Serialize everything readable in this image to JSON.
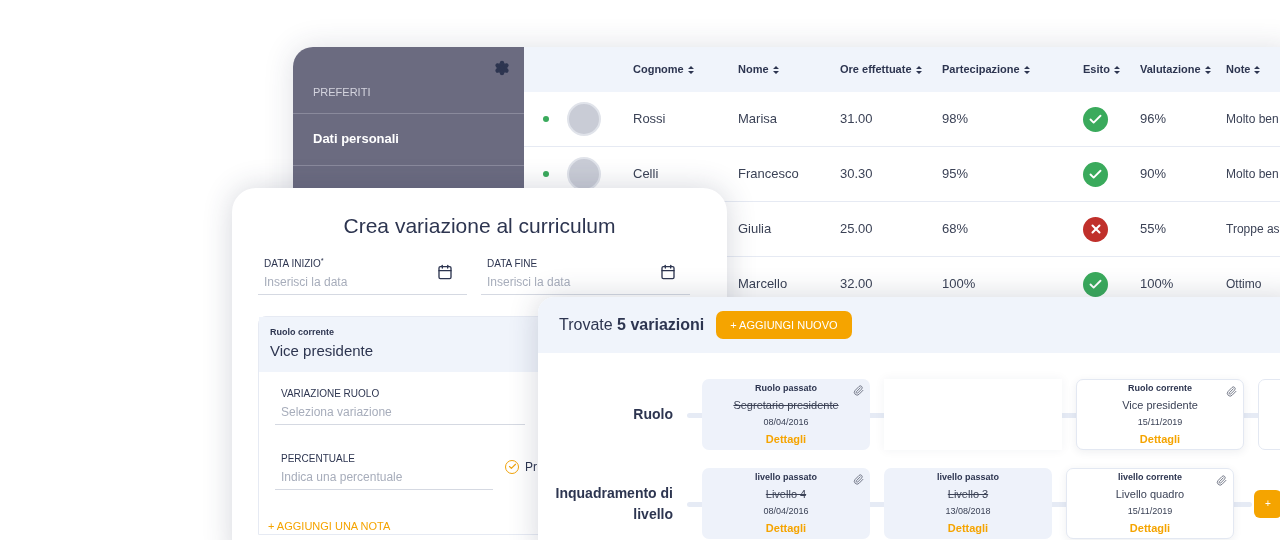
{
  "sidebar": {
    "section_title": "PREFERITI",
    "items": [
      {
        "label": "Dati personali",
        "selected": true
      }
    ]
  },
  "table": {
    "columns": [
      "Cognome",
      "Nome",
      "Ore effettuate",
      "Partecipazione",
      "Esito",
      "Valutazione",
      "Note"
    ],
    "rows": [
      {
        "online": true,
        "avatar": true,
        "cognome": "Rossi",
        "nome": "Marisa",
        "ore": "31.00",
        "partecipazione": "98%",
        "kind": "passed",
        "valutazione": "96%",
        "note": "Molto ben"
      },
      {
        "online": true,
        "avatar": true,
        "cognome": "Celli",
        "nome": "Francesco",
        "ore": "30.30",
        "partecipazione": "95%",
        "kind": "passed",
        "valutazione": "90%",
        "note": "Molto ben"
      },
      {
        "online": false,
        "avatar": false,
        "nome": "Giulia",
        "ore": "25.00",
        "partecipazione": "68%",
        "kind": "failed",
        "valutazione": "55%",
        "note": "Troppe as"
      },
      {
        "online": false,
        "avatar": false,
        "nome": "Marcello",
        "ore": "32.00",
        "partecipazione": "100%",
        "kind": "passed",
        "valutazione": "100%",
        "note": "Ottimo"
      }
    ]
  },
  "form": {
    "title": "Crea variazione al curriculum",
    "date_fields": [
      {
        "label": "DATA INIZIO$^{*}$",
        "placeholder": "Inserisci la data"
      },
      {
        "label": "DATA FINE",
        "placeholder": "Inserisci la data"
      }
    ],
    "current_role": {
      "label": "Ruolo corrente",
      "value": "Vice presidente"
    },
    "role_field": {
      "label": "VARIAZIONE RUOLO",
      "placeholder": "Seleziona variazione"
    },
    "percent_field": {
      "label": "PERCENTUALE",
      "placeholder": "Indica una percentuale"
    },
    "checkbox": {
      "label": "Pr",
      "checked": true
    },
    "add_note": "+ AGGIUNGI UNA NOTA"
  },
  "variations": {
    "title": "Trovate **5 variazioni**",
    "add_button": "+ AGGIUNGI NUOVO",
    "rows": [
      {
        "label": "Ruolo",
        "cards": [
          {
            "kind": "past",
            "title": "Ruolo passato",
            "value": "Segretario presidente",
            "date": "08/04/2016",
            "link": "Dettagli",
            "attachment": true
          },
          {
            "kind": "empty"
          },
          {
            "kind": "current",
            "title": "Ruolo corrente",
            "value": "Vice presidente",
            "date": "15/11/2019",
            "link": "Dettagli",
            "attachment": true
          },
          {
            "kind": "partial"
          }
        ]
      },
      {
        "label": "Inquadramento di livello",
        "cards": [
          {
            "kind": "past",
            "title": "livello passato",
            "value": "Livello 4",
            "date": "08/04/2016",
            "link": "Dettagli",
            "attachment": true
          },
          {
            "kind": "past",
            "title": "livello passato",
            "value": "Livello 3",
            "date": "13/08/2018",
            "link": "Dettagli",
            "attachment": false
          },
          {
            "kind": "current",
            "title": "livello corrente",
            "value": "Livello quadro",
            "date": "15/11/2019",
            "link": "Dettagli",
            "attachment": true
          },
          {
            "kind": "add",
            "label": "+"
          }
        ]
      }
    ]
  }
}
